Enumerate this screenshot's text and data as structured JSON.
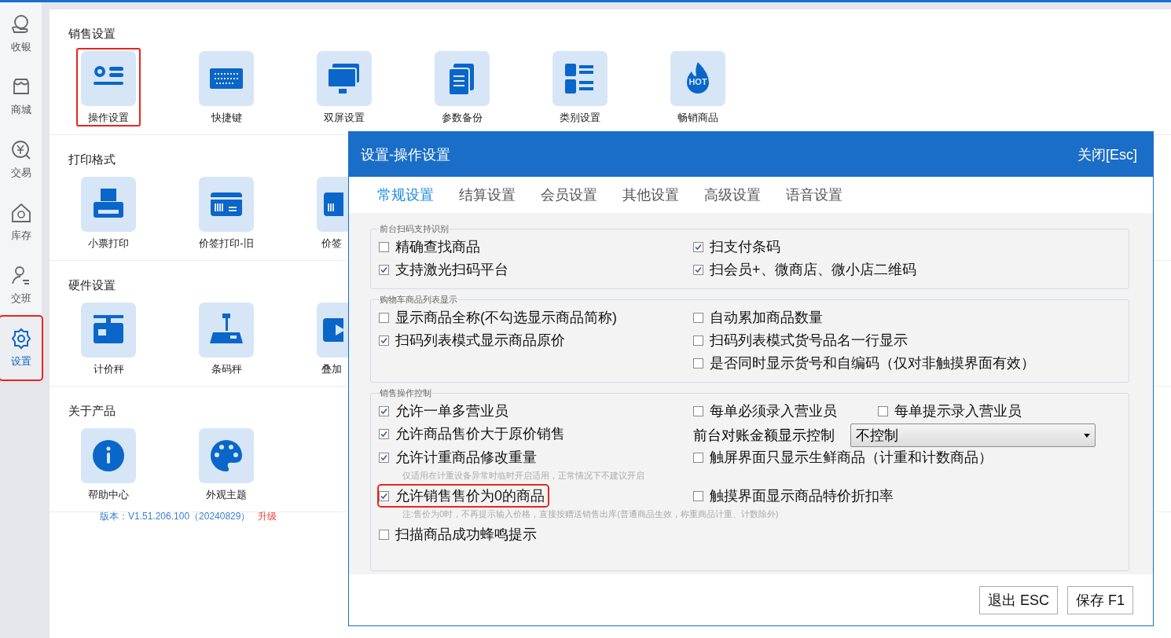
{
  "sidebar": {
    "items": [
      {
        "label": "收银",
        "selected": false,
        "highlighted": false
      },
      {
        "label": "商城",
        "selected": false,
        "highlighted": false
      },
      {
        "label": "交易",
        "selected": false,
        "highlighted": false
      },
      {
        "label": "库存",
        "selected": false,
        "highlighted": false
      },
      {
        "label": "交班",
        "selected": false,
        "highlighted": false
      },
      {
        "label": "设置",
        "selected": true,
        "highlighted": true
      }
    ]
  },
  "sections": [
    {
      "title": "销售设置",
      "tiles": [
        {
          "label": "操作设置",
          "highlighted": true
        },
        {
          "label": "快捷键",
          "highlighted": false
        },
        {
          "label": "双屏设置",
          "highlighted": false
        },
        {
          "label": "参数备份",
          "highlighted": false
        },
        {
          "label": "类别设置",
          "highlighted": false
        },
        {
          "label": "畅销商品",
          "highlighted": false,
          "badge": "HOT"
        }
      ]
    },
    {
      "title": "打印格式",
      "tiles": [
        {
          "label": "小票打印",
          "highlighted": false
        },
        {
          "label": "价签打印-旧",
          "highlighted": false
        },
        {
          "label": "价签",
          "highlighted": false,
          "cut_off": true
        }
      ]
    },
    {
      "title": "硬件设置",
      "tiles": [
        {
          "label": "计价秤",
          "highlighted": false
        },
        {
          "label": "条码秤",
          "highlighted": false
        },
        {
          "label": "叠加",
          "highlighted": false,
          "cut_off": true
        }
      ]
    },
    {
      "title": "关于产品",
      "tiles": [
        {
          "label": "帮助中心",
          "highlighted": false
        },
        {
          "label": "外观主题",
          "highlighted": false
        }
      ]
    }
  ],
  "version": {
    "text": "版本：V1.51.206.100（20240829）",
    "link": "升级"
  },
  "dialog": {
    "title": "设置-操作设置",
    "close": "关闭[Esc]",
    "tabs": [
      {
        "label": "常规设置",
        "selected": true
      },
      {
        "label": "结算设置",
        "selected": false
      },
      {
        "label": "会员设置",
        "selected": false
      },
      {
        "label": "其他设置",
        "selected": false
      },
      {
        "label": "高级设置",
        "selected": false
      },
      {
        "label": "语音设置",
        "selected": false
      }
    ],
    "groups": [
      {
        "legend": "前台扫码支持识别",
        "rows": [
          {
            "left": [
              {
                "kind": "checkbox",
                "label": "精确查找商品",
                "checked": false,
                "highlighted": false
              }
            ],
            "right": [
              {
                "kind": "checkbox",
                "label": "扫支付条码",
                "checked": true,
                "highlighted": false
              }
            ]
          },
          {
            "left": [
              {
                "kind": "checkbox",
                "label": "支持激光扫码平台",
                "checked": true,
                "highlighted": false
              }
            ],
            "right": [
              {
                "kind": "checkbox",
                "label": "扫会员+、微商店、微小店二维码",
                "checked": true,
                "highlighted": false
              }
            ]
          }
        ]
      },
      {
        "legend": "购物车商品列表显示",
        "rows": [
          {
            "left": [
              {
                "kind": "checkbox",
                "label": "显示商品全称(不勾选显示商品简称)",
                "checked": false,
                "highlighted": false
              }
            ],
            "right": [
              {
                "kind": "checkbox",
                "label": "自动累加商品数量",
                "checked": false,
                "highlighted": false
              }
            ]
          },
          {
            "left": [
              {
                "kind": "checkbox",
                "label": "扫码列表模式显示商品原价",
                "checked": true,
                "highlighted": false
              }
            ],
            "right": [
              {
                "kind": "checkbox",
                "label": "扫码列表模式货号品名一行显示",
                "checked": false,
                "highlighted": false
              }
            ]
          },
          {
            "left": [],
            "right": [
              {
                "kind": "checkbox",
                "label": "是否同时显示货号和自编码（仅对非触摸界面有效）",
                "checked": false,
                "highlighted": false
              }
            ]
          }
        ]
      },
      {
        "legend": "销售操作控制",
        "rows": [
          {
            "left": [
              {
                "kind": "checkbox",
                "label": "允许一单多营业员",
                "checked": true,
                "highlighted": false
              }
            ],
            "right": [
              {
                "kind": "checkbox",
                "label": "每单必须录入营业员",
                "checked": false,
                "highlighted": false
              },
              {
                "kind": "checkbox",
                "label": "每单提示录入营业员",
                "checked": false,
                "highlighted": false
              }
            ]
          },
          {
            "left": [
              {
                "kind": "checkbox",
                "label": "允许商品售价大于原价销售",
                "checked": true,
                "highlighted": false
              }
            ],
            "right": [
              {
                "kind": "select",
                "label": "前台对账金额显示控制",
                "value": "不控制"
              }
            ]
          },
          {
            "left": [
              {
                "kind": "checkbox",
                "label": "允许计重商品修改重量",
                "checked": true,
                "highlighted": false
              },
              {
                "kind": "note",
                "label": "仅适用在计重设备异常时临时开启适用，正常情况下不建议开启"
              }
            ],
            "right": [
              {
                "kind": "checkbox",
                "label": "触屏界面只显示生鲜商品（计重和计数商品）",
                "checked": false,
                "highlighted": false
              }
            ]
          },
          {
            "left": [
              {
                "kind": "checkbox",
                "label": "允许销售售价为0的商品",
                "checked": true,
                "highlighted": true
              }
            ],
            "right": [
              {
                "kind": "checkbox",
                "label": "触摸界面显示商品特价折扣率",
                "checked": false,
                "highlighted": false
              }
            ]
          },
          {
            "left": [
              {
                "kind": "note",
                "label": "注:售价为0时，不再提示输入价格，直接按赠送销售出库(普通商品生效，称重商品计重、计数除外)"
              }
            ],
            "right": []
          },
          {
            "left": [
              {
                "kind": "checkbox",
                "label": "扫描商品成功蜂鸣提示",
                "checked": false,
                "highlighted": false
              }
            ],
            "right": []
          }
        ]
      }
    ],
    "buttons": [
      "退出 ESC",
      "保存 F1"
    ]
  }
}
